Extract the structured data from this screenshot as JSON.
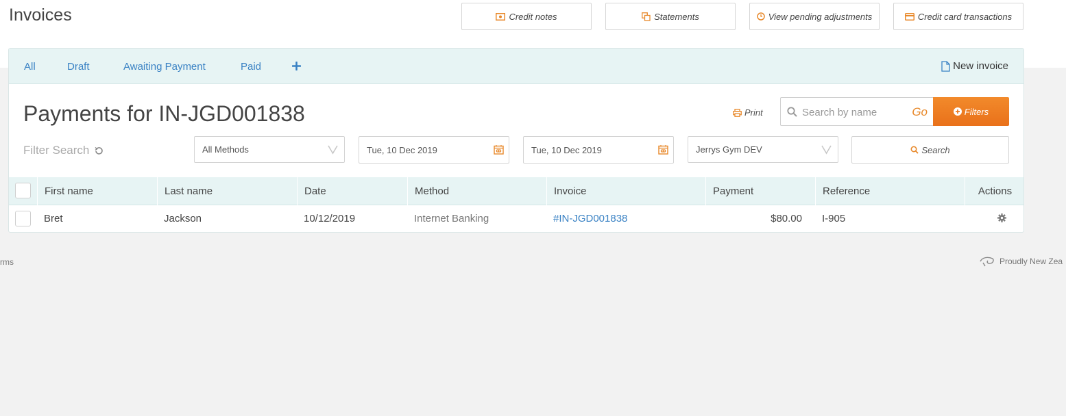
{
  "page": {
    "title": "Invoices"
  },
  "top_buttons": {
    "credit_notes": "Credit notes",
    "statements": "Statements",
    "pending": "View pending adjustments",
    "cc_transactions": "Credit card transactions"
  },
  "tabs": [
    "All",
    "Draft",
    "Awaiting Payment",
    "Paid"
  ],
  "new_invoice": "New invoice",
  "heading": "Payments for IN-JGD001838",
  "toolbar": {
    "print": "Print",
    "search_placeholder": "Search by name",
    "go": "Go",
    "filters": "Filters"
  },
  "filters": {
    "filter_search": "Filter Search",
    "method": "All Methods",
    "date_from": "Tue, 10 Dec 2019",
    "date_to": "Tue, 10 Dec 2019",
    "location": "Jerrys Gym DEV",
    "search": "Search"
  },
  "table": {
    "columns": [
      "First name",
      "Last name",
      "Date",
      "Method",
      "Invoice",
      "Payment",
      "Reference",
      "Actions"
    ],
    "rows": [
      {
        "first": "Bret",
        "last": "Jackson",
        "date": "10/12/2019",
        "method": "Internet Banking",
        "invoice": "#IN-JGD001838",
        "payment": "$80.00",
        "reference": "I-905"
      }
    ]
  },
  "footer": {
    "left": "rms",
    "right": "Proudly New Zea"
  },
  "colors": {
    "accent": "#e9711a",
    "link": "#3a82c4",
    "tab_bg": "#e7f4f4"
  }
}
